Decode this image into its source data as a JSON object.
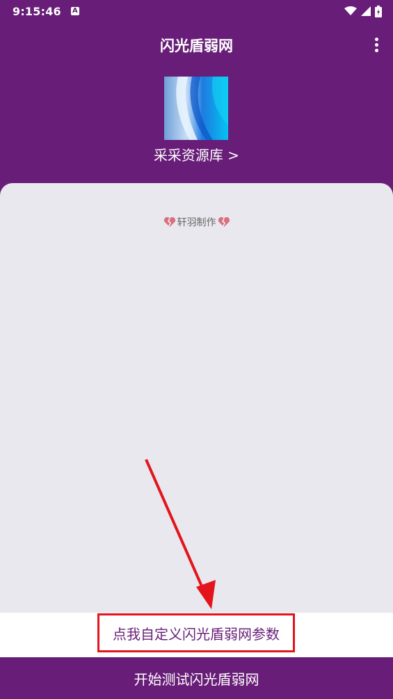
{
  "status_bar": {
    "time": "9:15:46",
    "icons": [
      "a-icon",
      "wifi-icon",
      "signal-icon",
      "battery-icon"
    ]
  },
  "app_bar": {
    "title": "闪光盾弱网",
    "menu_icon": "more-vert-icon"
  },
  "header": {
    "library_link": "采采资源库 >"
  },
  "content": {
    "author_text": "轩羽制作",
    "author_icon": "broken-heart-icon"
  },
  "params_link": "点我自定义闪光盾弱网参数",
  "start_button": "开始测试闪光盾弱网",
  "colors": {
    "primary": "#681e78",
    "card_bg": "#e8e8ee",
    "highlight": "#e3141c"
  }
}
